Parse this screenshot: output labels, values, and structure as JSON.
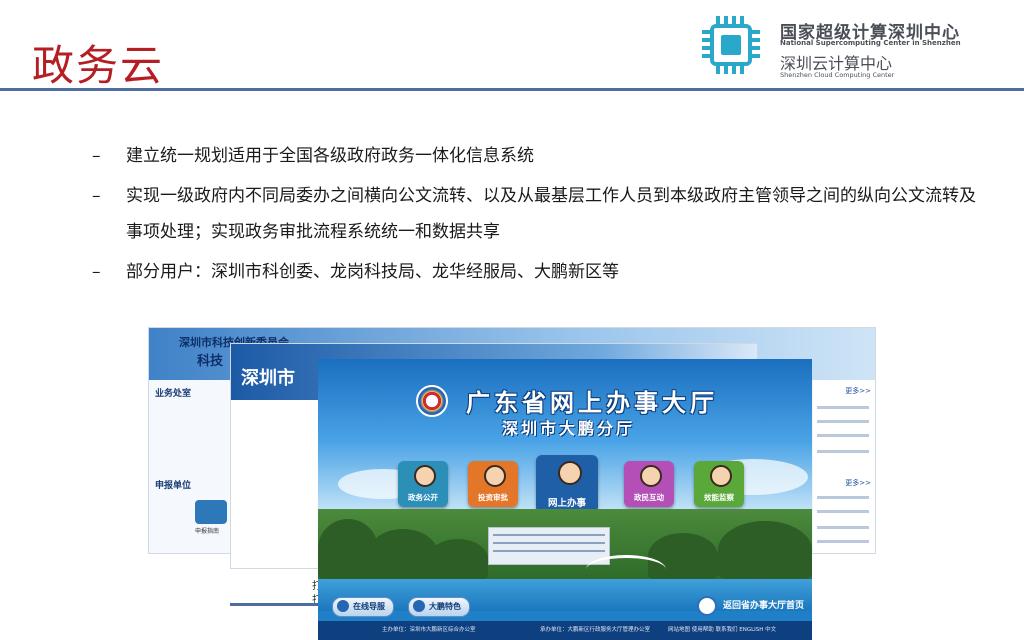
{
  "header": {
    "title": "政务云",
    "logo": {
      "name_cn": "国家超级计算深圳中心",
      "name_en": "National Supercomputing Center in Shenzhen",
      "sub_cn": "深圳云计算中心",
      "sub_en": "Shenzhen Cloud Computing Center",
      "icon": "chip-icon",
      "color": "#2aa8c9"
    },
    "accent_color": "#b51f24",
    "rule_color": "#4d6e9e"
  },
  "bullets": [
    "建立统一规划适用于全国各级政府政务一体化信息系统",
    "实现一级政府内不同局委办之间横向公文流转、以及从最基层工作人员到本级政府主管领导之间的纵向公文流转及事项处理；实现政务审批流程系统统一和数据共享",
    "部分用户：深圳市科创委、龙岗科技局、龙华经服局、大鹏新区等"
  ],
  "collage": {
    "back": {
      "title_line1": "深圳市科技创新委员会",
      "title_line2": "科技",
      "side_tab1": "业务处室",
      "side_tab2": "申报单位",
      "side_icon_label": "申报指南",
      "more1": "更多>>",
      "more2": "更多>>"
    },
    "middle": {
      "title": "深圳市",
      "text1": "打",
      "text2": "打"
    },
    "front": {
      "title": "广东省网上办事大厅",
      "subtitle": "深圳市大鹏分厅",
      "tiles": [
        {
          "label": "政务公开",
          "color": "#2b8fb8",
          "icon": "person-icon"
        },
        {
          "label": "投资审批",
          "color": "#e4762a",
          "icon": "person-icon"
        },
        {
          "label": "网上办事",
          "color": "#1f5fa8",
          "icon": "person-icon"
        },
        {
          "label": "政民互动",
          "color": "#b34fb6",
          "icon": "person-icon"
        },
        {
          "label": "效能监察",
          "color": "#5aa83a",
          "icon": "person-icon"
        }
      ],
      "buttons": {
        "guide": "在线导服",
        "feature": "大鹏特色",
        "home": "返回省办事大厅首页"
      },
      "footer": {
        "host": "主办单位：深圳市大鹏新区综合办公室",
        "undertaker": "承办单位：大鹏新区行政服务大厅管理办公室",
        "links": "网站地图  使用帮助  联系我们  ENGLISH  中文"
      }
    }
  }
}
